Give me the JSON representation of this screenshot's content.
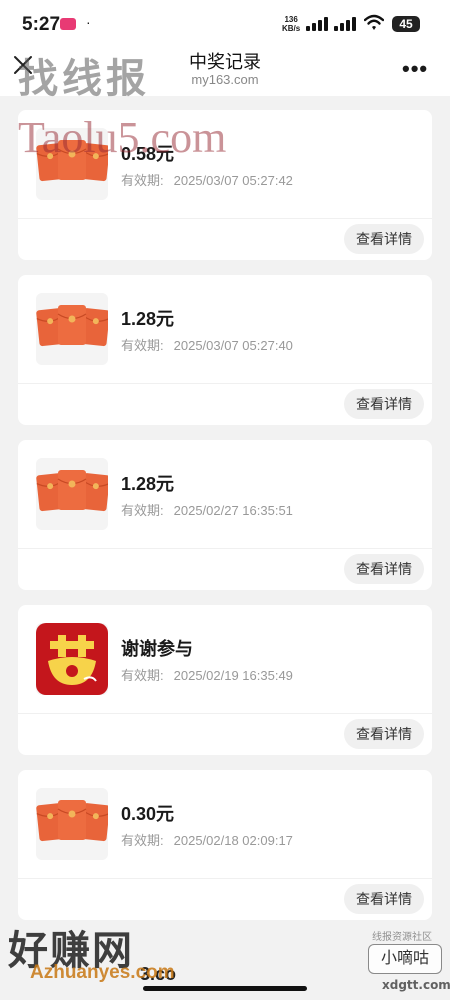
{
  "status_bar": {
    "time": "5:27",
    "dot": "·",
    "net_speed_value": "136",
    "net_speed_unit": "KB/s",
    "battery": "45"
  },
  "nav": {
    "title": "中奖记录",
    "url": "my163.com"
  },
  "records": [
    {
      "title": "0.58元",
      "validity_label": "有效期:",
      "validity_time": "2025/03/07 05:27:42",
      "button": "查看详情",
      "icon": "red-envelope-icon"
    },
    {
      "title": "1.28元",
      "validity_label": "有效期:",
      "validity_time": "2025/03/07 05:27:40",
      "button": "查看详情",
      "icon": "red-envelope-icon"
    },
    {
      "title": "1.28元",
      "validity_label": "有效期:",
      "validity_time": "2025/02/27 16:35:51",
      "button": "查看详情",
      "icon": "red-envelope-icon"
    },
    {
      "title": "谢谢参与",
      "validity_label": "有效期:",
      "validity_time": "2025/02/19 16:35:49",
      "button": "查看详情",
      "icon": "dream-game-logo-icon"
    },
    {
      "title": "0.30元",
      "validity_label": "有效期:",
      "validity_time": "2025/02/18 02:09:17",
      "button": "查看详情",
      "icon": "red-envelope-icon"
    }
  ],
  "peek_text": "3.co",
  "watermarks": {
    "top_cn": "找线报",
    "top_en": "Taolu5.com",
    "bottom_cn": "好赚网",
    "bottom_url": "Azhuanyes.com",
    "bottom_right_top": "线报资源社区",
    "bottom_right_badge": "小嘀咕",
    "bottom_right_url": "xdgtt.com"
  },
  "colors": {
    "page_bg": "#f2f2f2",
    "card_bg": "#ffffff",
    "envelope_orange": "#e8643a",
    "envelope_gold": "#f2b55a",
    "button_bg": "#f0f0f0",
    "muted_text": "#999999"
  }
}
